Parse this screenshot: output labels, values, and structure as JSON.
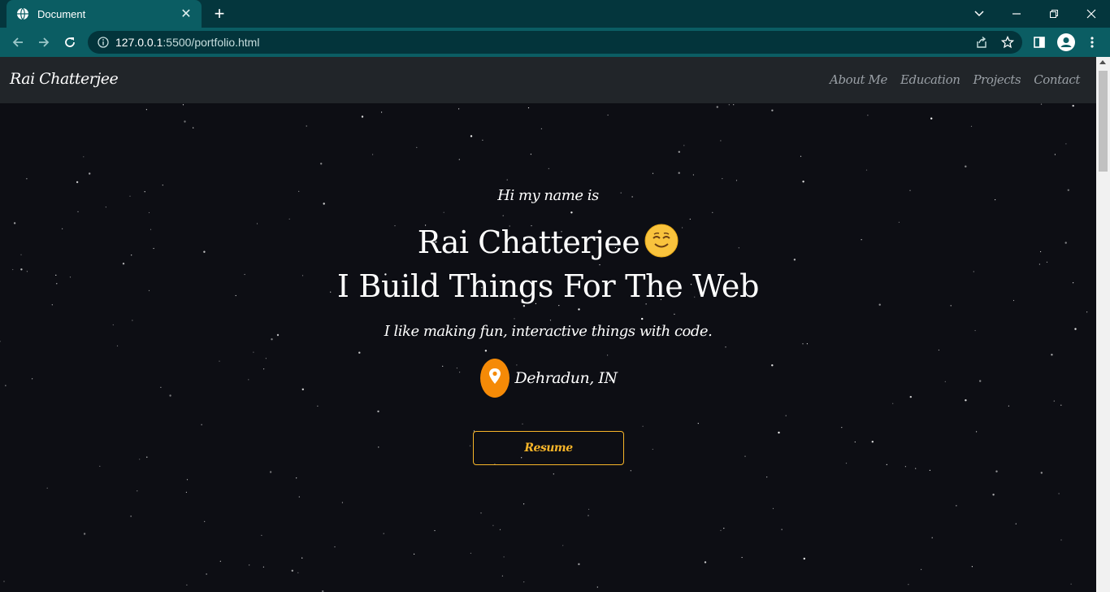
{
  "browser": {
    "tab_title": "Document",
    "new_tab_symbol": "+",
    "close_tab_symbol": "✕",
    "url_host": "127.0.0.1",
    "url_rest": ":5500/portfolio.html",
    "icons": [
      "globe-icon",
      "back-icon",
      "forward-icon",
      "reload-icon",
      "info-icon",
      "share-icon",
      "bookmark-star-icon",
      "side-panel-icon",
      "profile-icon",
      "menu-icon",
      "tab-search-icon",
      "minimize-icon",
      "restore-icon",
      "close-window-icon"
    ]
  },
  "navbar": {
    "brand": "Rai Chatterjee",
    "links": [
      "About Me",
      "Education",
      "Projects",
      "Contact"
    ]
  },
  "hero": {
    "greeting": "Hi my name is",
    "name": "Rai Chatterjee",
    "tagline": "I Build Things For The Web",
    "subtitle": "I like making fun, interactive things with code.",
    "location": "Dehradun, IN",
    "resume_label": "Resume"
  },
  "colors": {
    "tab_strip": "#04363d",
    "toolbar": "#0b5d63",
    "navbar": "#212529",
    "page_background": "#0d0e14",
    "accent": "#f7b529",
    "pin": "#f58a07"
  }
}
